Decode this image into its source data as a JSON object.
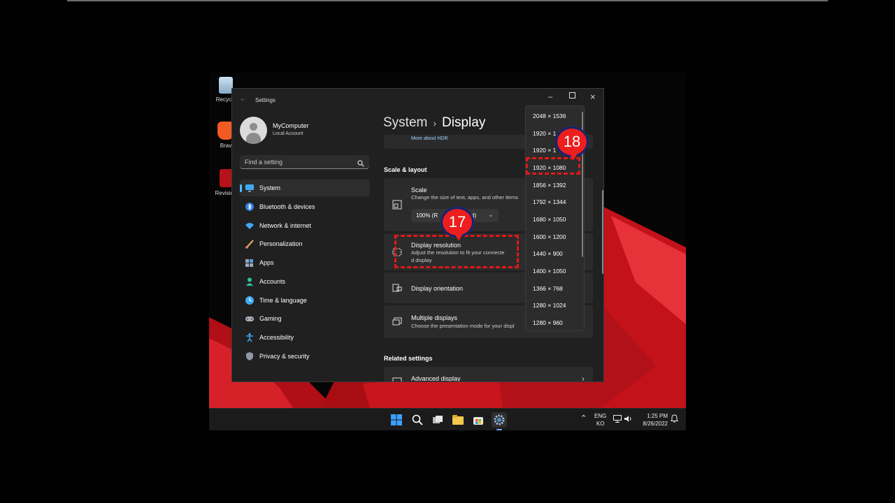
{
  "desktop": {
    "icons": [
      {
        "label": "Recycle"
      },
      {
        "label": "Brav"
      },
      {
        "label": "Revision"
      }
    ]
  },
  "window": {
    "title": "Settings"
  },
  "account": {
    "name": "MyComputer",
    "type": "Local Account"
  },
  "search": {
    "placeholder": "Find a setting"
  },
  "nav": {
    "items": [
      {
        "label": "System"
      },
      {
        "label": "Bluetooth & devices"
      },
      {
        "label": "Network & internet"
      },
      {
        "label": "Personalization"
      },
      {
        "label": "Apps"
      },
      {
        "label": "Accounts"
      },
      {
        "label": "Time & language"
      },
      {
        "label": "Gaming"
      },
      {
        "label": "Accessibility"
      },
      {
        "label": "Privacy & security"
      }
    ]
  },
  "breadcrumb": {
    "parent": "System",
    "separator": "›",
    "current": "Display"
  },
  "content": {
    "hdr_link": "More about HDR",
    "scale_layout_title": "Scale & layout",
    "scale": {
      "title": "Scale",
      "subtitle": "Change the size of text, apps, and other items",
      "value_left": "100% (R",
      "value_right": "d)"
    },
    "resolution": {
      "title": "Display resolution",
      "subtitle_line1": "Adjust the resolution to fit your connecte",
      "subtitle_line2": "d display"
    },
    "orientation": {
      "title": "Display orientation"
    },
    "multiple": {
      "title": "Multiple displays",
      "subtitle": "Choose the presentation mode for your displ"
    },
    "related_title": "Related settings",
    "advanced": {
      "title": "Advanced display"
    }
  },
  "dropdown": {
    "options": [
      "2048 × 1536",
      "1920 × 1",
      "1920 × 1",
      "1920 × 1080",
      "1856 × 1392",
      "1792 × 1344",
      "1680 × 1050",
      "1600 × 1200",
      "1440 × 900",
      "1400 × 1050",
      "1366 × 768",
      "1280 × 1024",
      "1280 × 960"
    ]
  },
  "callouts": {
    "step17": "17",
    "step18": "18"
  },
  "taskbar": {
    "lang_top": "ENG",
    "lang_bottom": "KO",
    "time": "1:25 PM",
    "date": "8/26/2022"
  },
  "colors": {
    "accent": "#4cc2ff",
    "callout_red": "#ec1e1e",
    "callout_border": "#15206b",
    "window_bg": "#202020",
    "card_bg": "#2b2b2b",
    "wallpaper_red": "#d4141c"
  }
}
